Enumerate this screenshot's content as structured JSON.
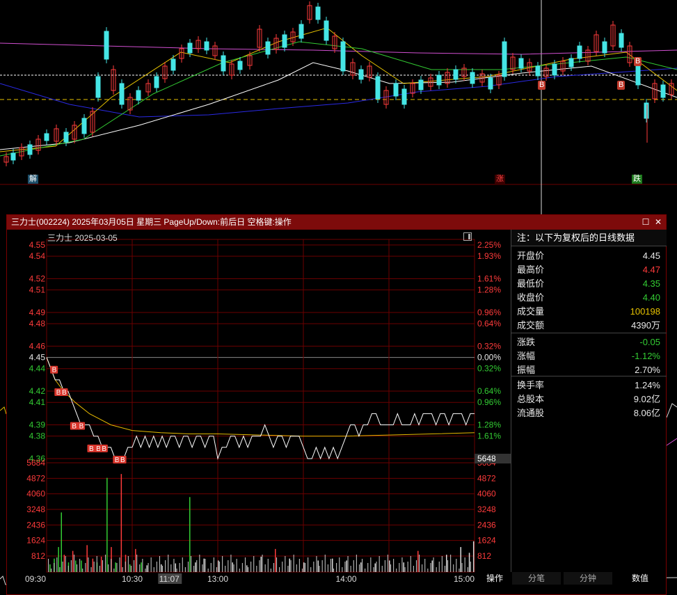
{
  "background": {
    "markers": [
      "解",
      "涨",
      "B",
      "B",
      "B",
      "跌"
    ]
  },
  "window": {
    "title": "三力士(002224) 2025年03月05日 星期三 PageUp/Down:前后日 空格键:操作",
    "max_icon": "maximize-icon",
    "close_icon": "close-icon"
  },
  "stock_label": "三力士   2025-03-05",
  "chart_data": {
    "type": "line",
    "title": "",
    "price_axis": {
      "ticks": [
        4.55,
        4.54,
        4.52,
        4.51,
        4.49,
        4.48,
        4.46,
        4.45,
        4.44,
        4.42,
        4.41,
        4.39,
        4.38,
        4.36
      ],
      "labels": [
        "4.55",
        "4.54",
        "4.52",
        "4.51",
        "4.49",
        "4.48",
        "4.46",
        "4.45",
        "4.44",
        "4.42",
        "4.41",
        "4.39",
        "4.38",
        "4.36"
      ],
      "pct_labels": [
        "2.25%",
        "1.93%",
        "1.61%",
        "1.28%",
        "0.96%",
        "0.64%",
        "0.32%",
        "0.00%",
        "0.32%",
        "0.64%",
        "0.96%",
        "1.28%",
        "1.61%",
        "1.93%"
      ],
      "reference": 4.45
    },
    "volume_axis": {
      "ticks": [
        5684,
        4872,
        4060,
        3248,
        2436,
        1624,
        812
      ],
      "labels": [
        "5684",
        "4872",
        "4060",
        "3248",
        "2436",
        "1624",
        "812"
      ],
      "cursor_value": "5648"
    },
    "time_labels": [
      "09:30",
      "10:30",
      "11:07",
      "13:00",
      "14:00",
      "15:00"
    ],
    "price_series": [
      [
        0,
        4.45
      ],
      [
        3,
        4.44
      ],
      [
        6,
        4.43
      ],
      [
        9,
        4.43
      ],
      [
        12,
        4.42
      ],
      [
        15,
        4.42
      ],
      [
        18,
        4.41
      ],
      [
        21,
        4.4
      ],
      [
        24,
        4.39
      ],
      [
        27,
        4.39
      ],
      [
        30,
        4.39
      ],
      [
        33,
        4.38
      ],
      [
        36,
        4.38
      ],
      [
        39,
        4.37
      ],
      [
        42,
        4.37
      ],
      [
        45,
        4.37
      ],
      [
        48,
        4.36
      ],
      [
        51,
        4.36
      ],
      [
        54,
        4.36
      ],
      [
        57,
        4.37
      ],
      [
        60,
        4.37
      ],
      [
        63,
        4.38
      ],
      [
        66,
        4.37
      ],
      [
        69,
        4.38
      ],
      [
        72,
        4.37
      ],
      [
        75,
        4.38
      ],
      [
        78,
        4.37
      ],
      [
        81,
        4.38
      ],
      [
        84,
        4.37
      ],
      [
        87,
        4.38
      ],
      [
        90,
        4.38
      ],
      [
        93,
        4.37
      ],
      [
        96,
        4.38
      ],
      [
        99,
        4.38
      ],
      [
        102,
        4.37
      ],
      [
        105,
        4.38
      ],
      [
        108,
        4.38
      ],
      [
        111,
        4.37
      ],
      [
        114,
        4.38
      ],
      [
        117,
        4.38
      ],
      [
        120,
        4.36
      ],
      [
        123,
        4.37
      ],
      [
        126,
        4.37
      ],
      [
        129,
        4.38
      ],
      [
        132,
        4.38
      ],
      [
        135,
        4.37
      ],
      [
        138,
        4.38
      ],
      [
        141,
        4.37
      ],
      [
        144,
        4.38
      ],
      [
        147,
        4.38
      ],
      [
        150,
        4.38
      ],
      [
        153,
        4.39
      ],
      [
        156,
        4.38
      ],
      [
        159,
        4.37
      ],
      [
        162,
        4.38
      ],
      [
        165,
        4.38
      ],
      [
        168,
        4.37
      ],
      [
        171,
        4.38
      ],
      [
        174,
        4.38
      ],
      [
        177,
        4.38
      ],
      [
        180,
        4.37
      ],
      [
        183,
        4.36
      ],
      [
        186,
        4.36
      ],
      [
        189,
        4.37
      ],
      [
        192,
        4.36
      ],
      [
        195,
        4.37
      ],
      [
        198,
        4.36
      ],
      [
        201,
        4.37
      ],
      [
        204,
        4.36
      ],
      [
        207,
        4.37
      ],
      [
        210,
        4.38
      ],
      [
        213,
        4.39
      ],
      [
        216,
        4.39
      ],
      [
        219,
        4.38
      ],
      [
        222,
        4.39
      ],
      [
        225,
        4.39
      ],
      [
        228,
        4.4
      ],
      [
        231,
        4.4
      ],
      [
        234,
        4.39
      ],
      [
        237,
        4.39
      ],
      [
        240,
        4.39
      ],
      [
        243,
        4.39
      ],
      [
        246,
        4.4
      ],
      [
        249,
        4.39
      ],
      [
        252,
        4.39
      ],
      [
        255,
        4.39
      ],
      [
        258,
        4.4
      ],
      [
        261,
        4.39
      ],
      [
        264,
        4.4
      ],
      [
        267,
        4.4
      ],
      [
        270,
        4.4
      ],
      [
        273,
        4.39
      ],
      [
        276,
        4.4
      ],
      [
        279,
        4.4
      ],
      [
        282,
        4.39
      ],
      [
        285,
        4.4
      ],
      [
        288,
        4.4
      ],
      [
        291,
        4.4
      ],
      [
        294,
        4.39
      ],
      [
        297,
        4.4
      ],
      [
        300,
        4.4
      ]
    ],
    "avg_series": [
      [
        0,
        4.45
      ],
      [
        6,
        4.43
      ],
      [
        12,
        4.42
      ],
      [
        20,
        4.41
      ],
      [
        30,
        4.4
      ],
      [
        45,
        4.39
      ],
      [
        60,
        4.385
      ],
      [
        80,
        4.383
      ],
      [
        100,
        4.382
      ],
      [
        120,
        4.382
      ],
      [
        150,
        4.381
      ],
      [
        180,
        4.38
      ],
      [
        210,
        4.38
      ],
      [
        240,
        4.381
      ],
      [
        270,
        4.382
      ],
      [
        300,
        4.383
      ]
    ],
    "trade_markers": [
      {
        "t": 3,
        "price": 4.44,
        "label": "B"
      },
      {
        "t": 6,
        "price": 4.42,
        "label": "B"
      },
      {
        "t": 10,
        "price": 4.42,
        "label": "B"
      },
      {
        "t": 17,
        "price": 4.39,
        "label": "B"
      },
      {
        "t": 22,
        "price": 4.39,
        "label": "B"
      },
      {
        "t": 29,
        "price": 4.37,
        "label": "B"
      },
      {
        "t": 34,
        "price": 4.37,
        "label": "B"
      },
      {
        "t": 38,
        "price": 4.37,
        "label": "B"
      },
      {
        "t": 47,
        "price": 4.36,
        "label": "B"
      },
      {
        "t": 51,
        "price": 4.36,
        "label": "B"
      }
    ],
    "volume_series": [
      [
        2,
        400,
        "g"
      ],
      [
        5,
        700,
        "g"
      ],
      [
        8,
        1300,
        "g"
      ],
      [
        10,
        3100,
        "g"
      ],
      [
        12,
        900,
        "r"
      ],
      [
        15,
        500,
        "g"
      ],
      [
        18,
        1100,
        "r"
      ],
      [
        20,
        600,
        "g"
      ],
      [
        24,
        600,
        "g"
      ],
      [
        28,
        1400,
        "r"
      ],
      [
        32,
        700,
        "r"
      ],
      [
        35,
        500,
        "g"
      ],
      [
        38,
        800,
        "r"
      ],
      [
        42,
        4900,
        "g"
      ],
      [
        45,
        1300,
        "r"
      ],
      [
        48,
        500,
        "g"
      ],
      [
        52,
        5100,
        "r"
      ],
      [
        55,
        900,
        "r"
      ],
      [
        58,
        400,
        "g"
      ],
      [
        62,
        1200,
        "r"
      ],
      [
        66,
        500,
        "g"
      ],
      [
        70,
        350,
        "w"
      ],
      [
        80,
        400,
        "w"
      ],
      [
        90,
        450,
        "w"
      ],
      [
        100,
        3900,
        "g"
      ],
      [
        104,
        500,
        "w"
      ],
      [
        110,
        700,
        "w"
      ],
      [
        120,
        600,
        "w"
      ],
      [
        130,
        500,
        "w"
      ],
      [
        140,
        350,
        "w"
      ],
      [
        150,
        800,
        "w"
      ],
      [
        160,
        1200,
        "r"
      ],
      [
        170,
        700,
        "w"
      ],
      [
        180,
        500,
        "w"
      ],
      [
        190,
        600,
        "w"
      ],
      [
        200,
        700,
        "w"
      ],
      [
        210,
        600,
        "w"
      ],
      [
        220,
        500,
        "w"
      ],
      [
        230,
        450,
        "w"
      ],
      [
        240,
        600,
        "w"
      ],
      [
        250,
        500,
        "w"
      ],
      [
        260,
        1100,
        "r"
      ],
      [
        270,
        600,
        "w"
      ],
      [
        280,
        900,
        "w"
      ],
      [
        290,
        1300,
        "w"
      ],
      [
        296,
        1000,
        "w"
      ],
      [
        299,
        1600,
        "w"
      ]
    ]
  },
  "info": {
    "heading": "注：以下为复权后的日线数据",
    "rows": [
      {
        "label": "开盘价",
        "value": "4.45",
        "color": "#e8e8e8"
      },
      {
        "label": "最高价",
        "value": "4.47",
        "color": "#ff3b3b"
      },
      {
        "label": "最低价",
        "value": "4.35",
        "color": "#33cc33"
      },
      {
        "label": "收盘价",
        "value": "4.40",
        "color": "#33cc33"
      },
      {
        "label": "成交量",
        "value": "100198",
        "color": "#e6c200"
      },
      {
        "label": "成交额",
        "value": "4390万",
        "color": "#e8e8e8"
      },
      {
        "label": "涨跌",
        "value": "-0.05",
        "color": "#33cc33"
      },
      {
        "label": "涨幅",
        "value": "-1.12%",
        "color": "#33cc33"
      },
      {
        "label": "振幅",
        "value": "2.70%",
        "color": "#e8e8e8"
      },
      {
        "label": "换手率",
        "value": "1.24%",
        "color": "#e8e8e8"
      },
      {
        "label": "总股本",
        "value": "9.02亿",
        "color": "#e8e8e8"
      },
      {
        "label": "流通股",
        "value": "8.06亿",
        "color": "#e8e8e8"
      }
    ]
  },
  "bottom_tabs": [
    "操作",
    "分笔",
    "分钟",
    "数值"
  ],
  "colors": {
    "up": "#ff3b3b",
    "down": "#33cc33",
    "price_line": "#ffffff",
    "avg_line": "#e6b800",
    "grid": "#6b0000",
    "titlebar": "#7d0b0b"
  }
}
